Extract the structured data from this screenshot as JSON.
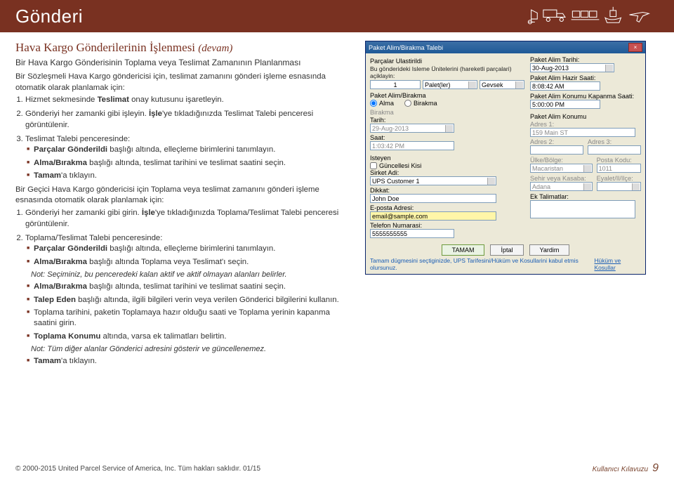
{
  "header": {
    "title": "Gönderi"
  },
  "section": {
    "subhead_main": "Hava Kargo Gönderilerinin İşlenmesi ",
    "subhead_suffix": "(devam)",
    "lead": "Bir Hava Kargo Gönderisinin Toplama veya Teslimat Zamanının Planlanması",
    "intro": "Bir Sözleşmeli Hava Kargo göndericisi için, teslimat zamanını gönderi işleme esnasında otomatik olarak planlamak için:",
    "step1_a": "Hizmet sekmesinde ",
    "step1_b": "Teslimat",
    "step1_c": " onay kutusunu işaretleyin.",
    "step2_a": "Gönderiyi her zamanki gibi işleyin. ",
    "step2_b": "İşle",
    "step2_c": "'ye tıkladığınızda Teslimat Talebi penceresi görüntülenir.",
    "step3": "Teslimat Talebi penceresinde:",
    "b1a": "Parçalar Gönderildi",
    "b1b": " başlığı altında, elleçleme birimlerini tanımlayın.",
    "b2a": "Alma/Bırakma",
    "b2b": " başlığı altında, teslimat tarihini ve teslimat saatini seçin.",
    "b3a": "Tamam",
    "b3b": "'a tıklayın.",
    "intro2": "Bir Geçici Hava Kargo göndericisi için Toplama veya teslimat zamanını gönderi işleme esnasında otomatik olarak planlamak için:",
    "s2_1_a": "Gönderiyi her zamanki gibi girin. ",
    "s2_1_b": "İşle",
    "s2_1_c": "'ye tıkladığınızda Toplama/Teslimat Talebi penceresi görüntülenir.",
    "s2_2": "Toplama/Teslimat Talebi penceresinde:",
    "c1a": "Parçalar Gönderildi",
    "c1b": " başlığı altında, elleçleme birimlerini tanımlayın.",
    "c2a": "Alma/Bırakma",
    "c2b": " başlığı altında Toplama veya Teslimat'ı seçin.",
    "note1": "Not: Seçiminiz, bu penceredeki kalan aktif ve aktif olmayan alanları belirler.",
    "c3a": "Alma/Bırakma",
    "c3b": " başlığı altında, teslimat tarihini ve teslimat saatini seçin.",
    "c4a": "Talep Eden",
    "c4b": " başlığı altında, ilgili bilgileri verin veya verilen Gönderici bilgilerini kullanın.",
    "c5": "Toplama tarihini, paketin Toplamaya hazır olduğu saati ve Toplama yerinin kapanma saatini girin.",
    "c6a": "Toplama Konumu",
    "c6b": " altında, varsa ek talimatları belirtin.",
    "note2": "Not: Tüm diğer alanlar Gönderici adresini gösterir ve güncellenemez.",
    "c7a": "Tamam",
    "c7b": "'a tıklayın."
  },
  "dialog": {
    "title": "Paket Alim/Birakma Talebi",
    "grp_parcalar": "Parçalar Ulastirildi",
    "hint_parcalar": "Bu gönderideki Isleme Ünitelerini (hareketli parçalari) açiklayin:",
    "qty": "1",
    "unit": "Palet(ler)",
    "loose": "Gevsek",
    "grp_alma": "Paket Alim/Birakma",
    "radio_alma": "Alma",
    "radio_birakma": "Birakma",
    "lbl_tarih": "Tarih:",
    "val_tarih": "29-Aug-2013",
    "lbl_saat": "Saat:",
    "val_saat": "1:03:42 PM",
    "grp_isteyen": "Isteyen",
    "lbl_guncellesid": "Güncellesi Kisi",
    "lbl_sirket": "Sirket Adi:",
    "val_sirket": "UPS Customer 1",
    "lbl_dikkat": "Dikkat:",
    "val_dikkat": "John Doe",
    "lbl_eposta": "E-posta Adresi:",
    "val_eposta": "email@sample.com",
    "lbl_tel": "Telefon Numarasi:",
    "val_tel": "5555555555",
    "r_lbl_paTarih": "Paket Alim Tarihi:",
    "r_val_paTarih": "30-Aug-2013",
    "r_lbl_paHazir": "Paket Alim Hazir Saati:",
    "r_val_paHazir": "8:08:42 AM",
    "r_lbl_paKapanma": "Paket Alim Konumu Kapanma Saati:",
    "r_val_paKapanma": "5:00:00 PM",
    "r_lbl_konum": "Paket Alim Konumu",
    "r_lbl_adres1": "Adres 1:",
    "r_val_adres1": "159 Main ST",
    "r_lbl_adres2": "Adres 2:",
    "r_lbl_adres3": "Adres 3:",
    "r_lbl_ulke": "Ülke/Bölge:",
    "r_val_ulke": "Macaristan",
    "r_lbl_pk": "Posta Kodu:",
    "r_val_pk": "1011",
    "r_lbl_sehir": "Sehir veya Kasaba:",
    "r_val_sehir": "Adana",
    "r_lbl_eyalet": "Eyalet/Il/Ilçe:",
    "r_lbl_ek": "Ek Talimatlar:",
    "btn_ok": "TAMAM",
    "btn_cancel": "İptal",
    "btn_help": "Yardim",
    "status": "Tamam dügmesini seçtiginizde, UPS Tarifesini/Hüküm ve Kosullarini kabul etmis olursunuz.",
    "link": "Hüküm ve Kosullar"
  },
  "footer": {
    "copyright": "© 2000-2015 United Parcel Service of America, Inc. Tüm hakları saklıdır. 01/15",
    "guide": "Kullanıcı Kılavuzu",
    "page": "9"
  }
}
